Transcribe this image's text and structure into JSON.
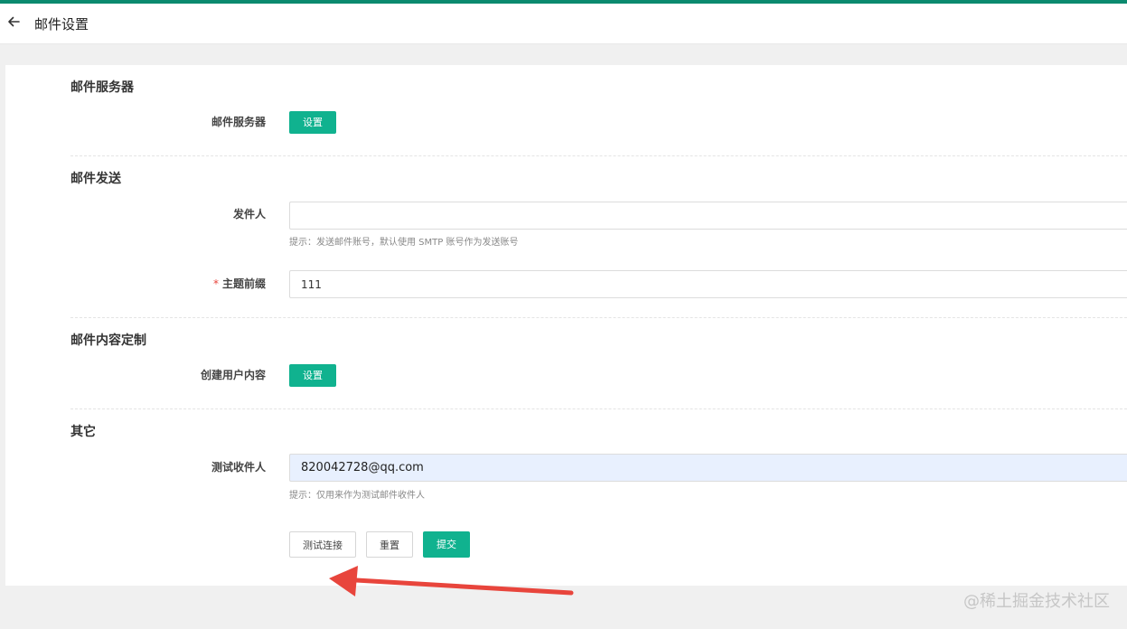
{
  "header": {
    "title": "邮件设置",
    "back_icon": "arrow-left-icon"
  },
  "sections": {
    "server": {
      "title": "邮件服务器",
      "label": "邮件服务器",
      "button": "设置"
    },
    "send": {
      "title": "邮件发送",
      "sender_label": "发件人",
      "sender_value": "",
      "sender_hint": "提示：发送邮件账号，默认使用 SMTP 账号作为发送账号",
      "subject_required_mark": "*",
      "subject_label": "主题前缀",
      "subject_value": "111"
    },
    "content": {
      "title": "邮件内容定制",
      "label": "创建用户内容",
      "button": "设置"
    },
    "other": {
      "title": "其它",
      "recipient_label": "测试收件人",
      "recipient_value": "820042728@qq.com",
      "recipient_hint": "提示：仅用来作为测试邮件收件人"
    }
  },
  "actions": {
    "test_connection": "测试连接",
    "reset": "重置",
    "submit": "提交"
  },
  "watermark": "@稀土掘金技术社区",
  "colors": {
    "accent": "#0b8a6f",
    "primary_button": "#10b28f",
    "annotation_arrow": "#e8453c",
    "filled_input": "#e8f0fe"
  }
}
